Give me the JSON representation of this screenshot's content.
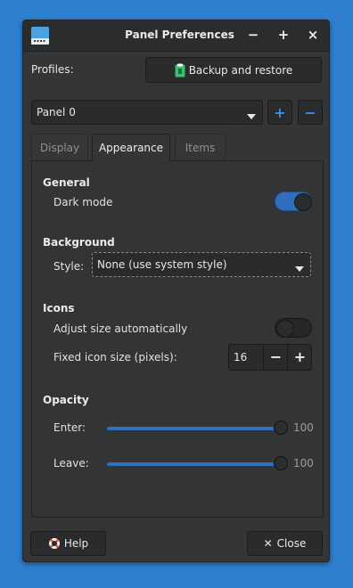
{
  "window": {
    "title": "Panel Preferences"
  },
  "titlebar_buttons": {
    "minimize": "−",
    "maximize": "+",
    "close": "×"
  },
  "profiles": {
    "label": "Profiles:",
    "backup_button": "Backup and restore"
  },
  "panel_select": {
    "value": "Panel 0",
    "add": "+",
    "remove": "−"
  },
  "tabs": [
    {
      "label": "Display"
    },
    {
      "label": "Appearance"
    },
    {
      "label": "Items"
    }
  ],
  "general": {
    "heading": "General",
    "dark_mode_label": "Dark mode",
    "dark_mode_on": true
  },
  "background": {
    "heading": "Background",
    "style_label": "Style:",
    "style_value": "None (use system style)"
  },
  "icons": {
    "heading": "Icons",
    "adjust_label": "Adjust size automatically",
    "adjust_on": false,
    "fixed_label": "Fixed icon size (pixels):",
    "fixed_value": "16",
    "minus": "−",
    "plus": "+"
  },
  "opacity": {
    "heading": "Opacity",
    "enter_label": "Enter:",
    "enter_value": "100",
    "leave_label": "Leave:",
    "leave_value": "100"
  },
  "footer": {
    "help": "Help",
    "close": "Close"
  },
  "colors": {
    "accent": "#2e6fbe",
    "desktop": "#2f7fd0"
  }
}
